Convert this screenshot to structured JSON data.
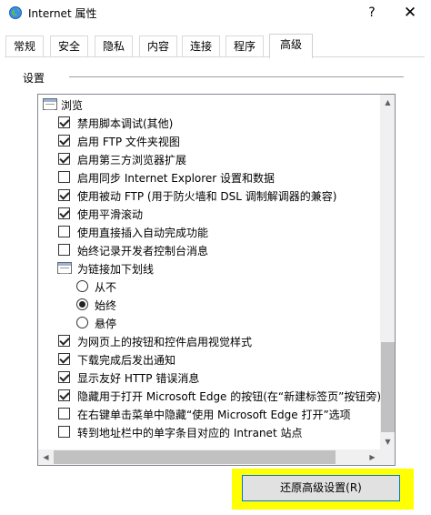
{
  "window": {
    "title": "Internet 属性",
    "help_label": "?",
    "close_label": "✕"
  },
  "tabs": [
    {
      "label": "常规",
      "active": false
    },
    {
      "label": "安全",
      "active": false
    },
    {
      "label": "隐私",
      "active": false
    },
    {
      "label": "内容",
      "active": false
    },
    {
      "label": "连接",
      "active": false
    },
    {
      "label": "程序",
      "active": false
    },
    {
      "label": "高级",
      "active": true
    }
  ],
  "settings": {
    "section_label": "设置",
    "items": [
      {
        "kind": "folder",
        "label": "浏览"
      },
      {
        "kind": "checkbox",
        "label": "禁用脚本调试(其他)",
        "checked": true
      },
      {
        "kind": "checkbox",
        "label": "启用 FTP 文件夹视图",
        "checked": true
      },
      {
        "kind": "checkbox",
        "label": "启用第三方浏览器扩展",
        "checked": true
      },
      {
        "kind": "checkbox",
        "label": "启用同步 Internet Explorer 设置和数据",
        "checked": false
      },
      {
        "kind": "checkbox",
        "label": "使用被动 FTP (用于防火墙和 DSL 调制解调器的兼容)",
        "checked": true
      },
      {
        "kind": "checkbox",
        "label": "使用平滑滚动",
        "checked": true
      },
      {
        "kind": "checkbox",
        "label": "使用直接插入自动完成功能",
        "checked": false
      },
      {
        "kind": "checkbox",
        "label": "始终记录开发者控制台消息",
        "checked": false
      },
      {
        "kind": "folder",
        "label": "为链接加下划线"
      },
      {
        "kind": "radio",
        "label": "从不",
        "checked": false
      },
      {
        "kind": "radio",
        "label": "始终",
        "checked": true
      },
      {
        "kind": "radio",
        "label": "悬停",
        "checked": false
      },
      {
        "kind": "checkbox",
        "label": "为网页上的按钮和控件启用视觉样式",
        "checked": true
      },
      {
        "kind": "checkbox",
        "label": "下载完成后发出通知",
        "checked": true
      },
      {
        "kind": "checkbox",
        "label": "显示友好 HTTP 错误消息",
        "checked": true
      },
      {
        "kind": "checkbox",
        "label": "隐藏用于打开 Microsoft Edge 的按钮(在“新建标签页”按钮旁)",
        "checked": true
      },
      {
        "kind": "checkbox",
        "label": "在右键单击菜单中隐藏“使用 Microsoft Edge 打开”选项",
        "checked": false
      },
      {
        "kind": "checkbox",
        "label": "转到地址栏中的单字条目对应的 Intranet 站点",
        "checked": false
      }
    ]
  },
  "restore_button": {
    "label": "还原高级设置(R)"
  },
  "colors": {
    "highlight": "#ffff00",
    "focus_border": "#0078d7",
    "button_face": "#e1e1e1"
  }
}
